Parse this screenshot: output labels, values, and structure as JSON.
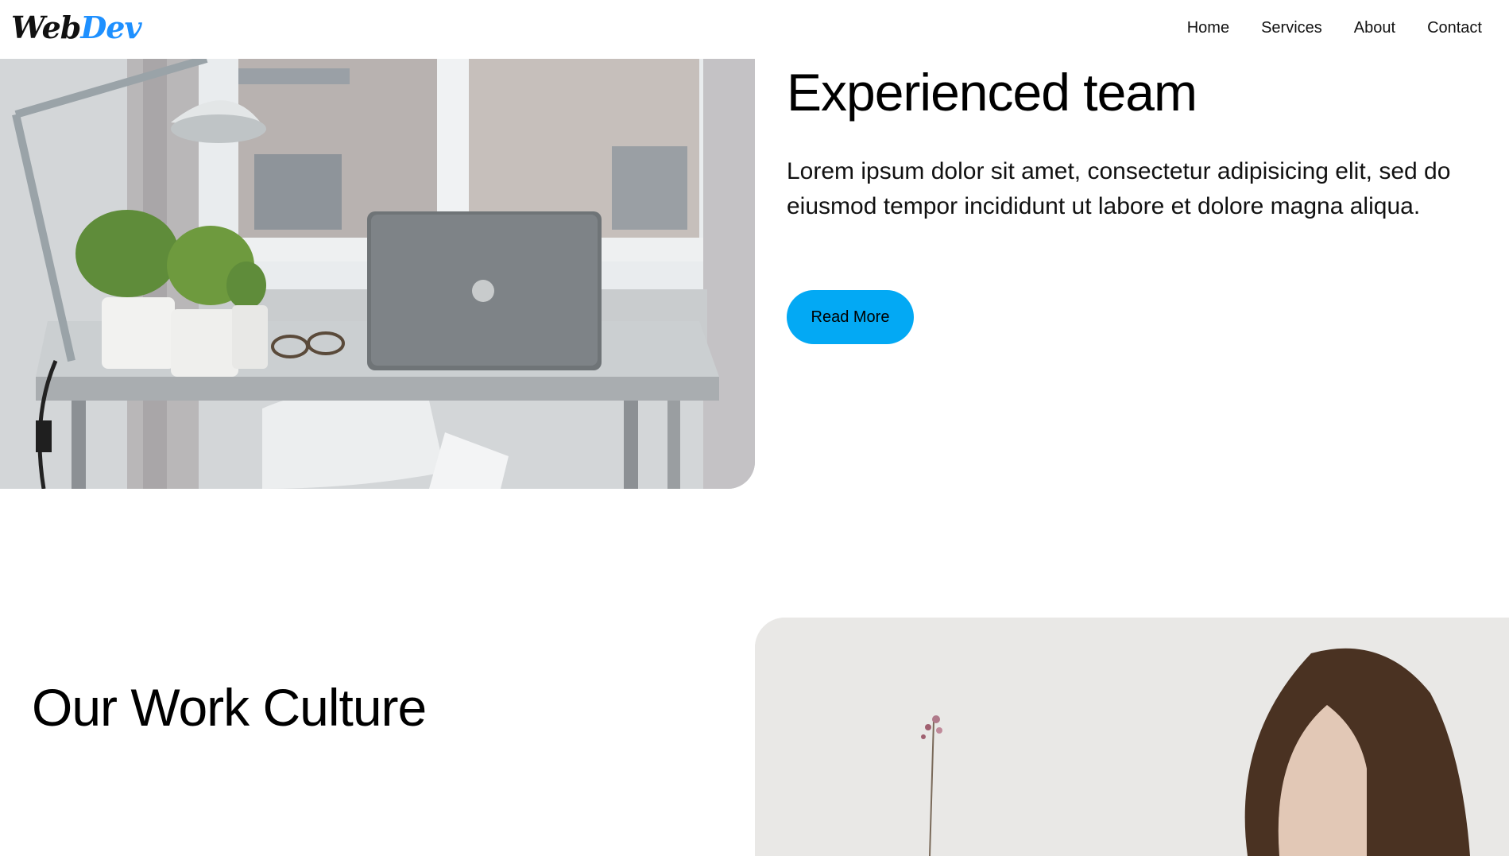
{
  "header": {
    "logo_part1": "Web",
    "logo_part2": "Dev",
    "nav": [
      "Home",
      "Services",
      "About",
      "Contact"
    ]
  },
  "section_team": {
    "title": "Experienced team",
    "text": "Lorem ipsum dolor sit amet, consectetur adipisicing elit, sed do eiusmod tempor incididunt ut labore et dolore magna aliqua.",
    "button_label": "Read More"
  },
  "section_culture": {
    "title": "Our Work Culture"
  },
  "colors": {
    "accent": "#03a9f4",
    "logo_accent": "#1e90ff"
  }
}
